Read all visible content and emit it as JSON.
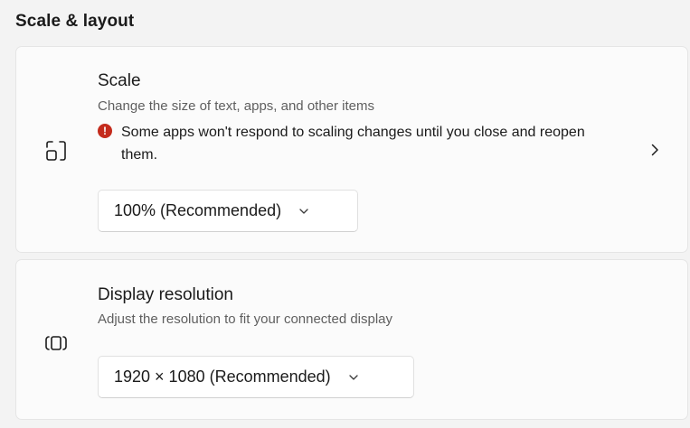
{
  "section": {
    "title": "Scale & layout"
  },
  "scale": {
    "title": "Scale",
    "description": "Change the size of text, apps, and other items",
    "warning_icon": "!",
    "warning": "Some apps won't respond to scaling changes until you close and reopen them.",
    "selected": "100% (Recommended)",
    "icon": "scale-icon",
    "expand_icon": "chevron-right-icon"
  },
  "resolution": {
    "title": "Display resolution",
    "description": "Adjust the resolution to fit your connected display",
    "selected": "1920 × 1080 (Recommended)",
    "icon": "display-resolution-icon"
  },
  "colors": {
    "background": "#f3f3f3",
    "card": "#fbfbfb",
    "warning": "#c42b1c"
  }
}
